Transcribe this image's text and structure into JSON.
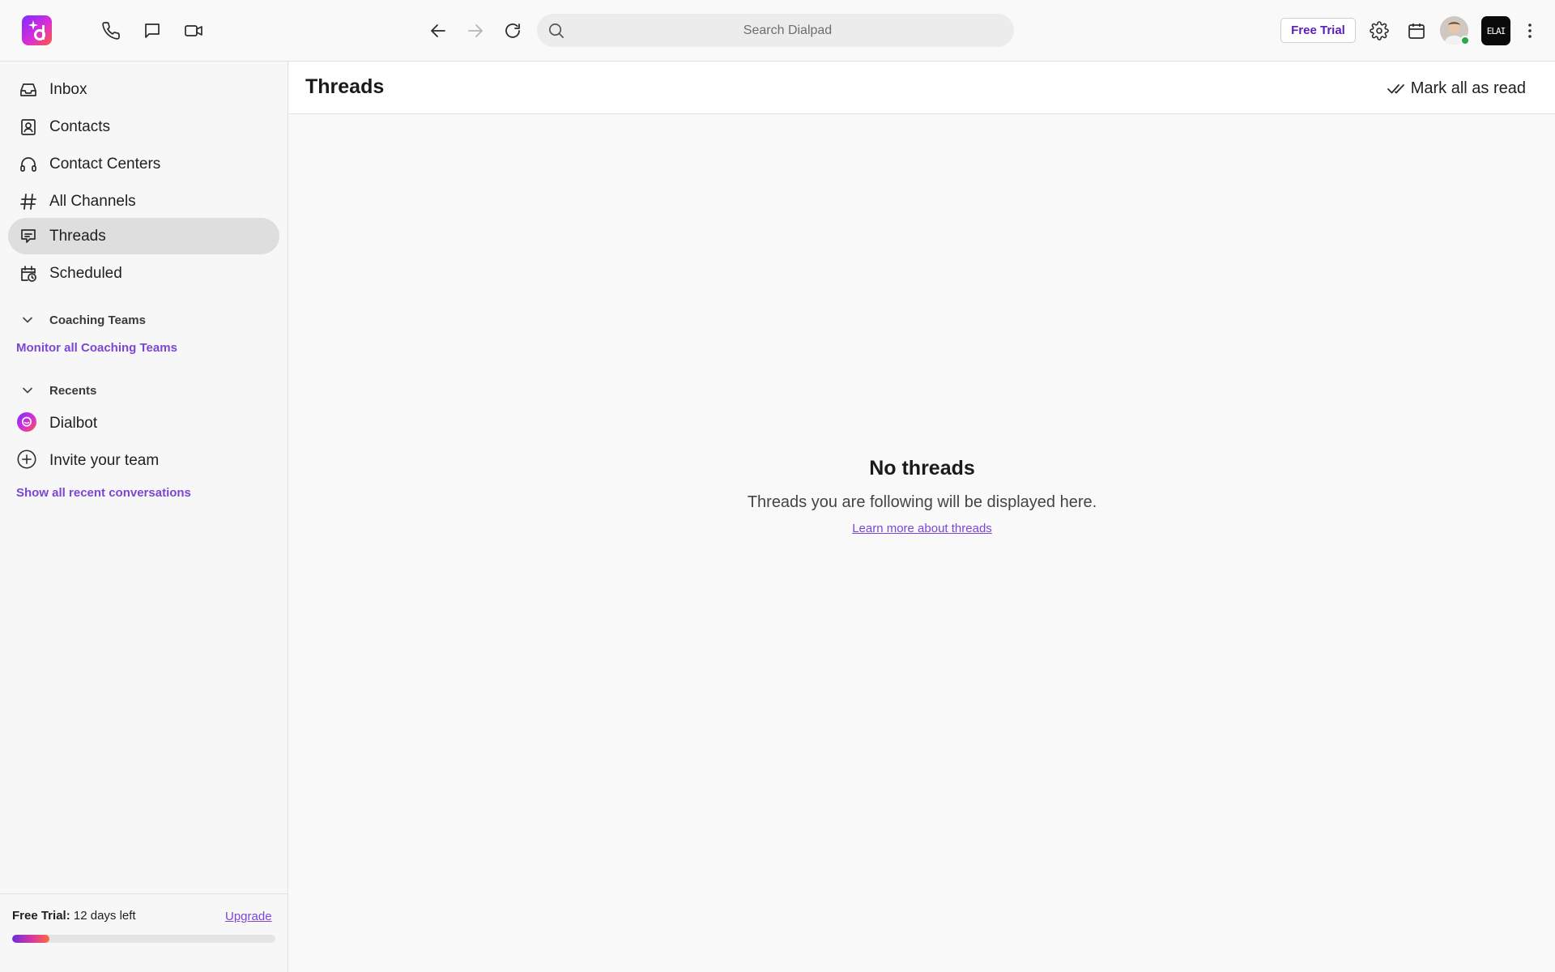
{
  "topbar": {
    "search_placeholder": "Search Dialpad",
    "free_trial_label": "Free Trial",
    "workspace_badge": "ELAI"
  },
  "sidebar": {
    "items": [
      {
        "label": "Inbox",
        "icon": "inbox-icon"
      },
      {
        "label": "Contacts",
        "icon": "contacts-icon"
      },
      {
        "label": "Contact Centers",
        "icon": "headset-icon"
      },
      {
        "label": "All Channels",
        "icon": "hash-icon"
      },
      {
        "label": "Threads",
        "icon": "threads-icon",
        "active": true
      },
      {
        "label": "Scheduled",
        "icon": "calendar-clock-icon"
      }
    ],
    "coaching": {
      "heading": "Coaching Teams",
      "link": "Monitor all Coaching Teams"
    },
    "recents": {
      "heading": "Recents",
      "items": [
        {
          "label": "Dialbot",
          "icon": "dialbot-icon"
        },
        {
          "label": "Invite your team",
          "icon": "plus-circle-icon"
        }
      ],
      "link": "Show all recent conversations"
    },
    "trial": {
      "label": "Free Trial:",
      "days_left": "12 days left",
      "upgrade": "Upgrade",
      "progress": 0.14
    }
  },
  "main": {
    "title": "Threads",
    "mark_all_read": "Mark all as read",
    "empty": {
      "title": "No threads",
      "description": "Threads you are following will be displayed here.",
      "link": "Learn more about threads"
    }
  },
  "colors": {
    "accent": "#7b46d6",
    "free_trial_text": "#5b1fb8",
    "active_item_bg": "#dedede",
    "status_online": "#2aa84a"
  }
}
